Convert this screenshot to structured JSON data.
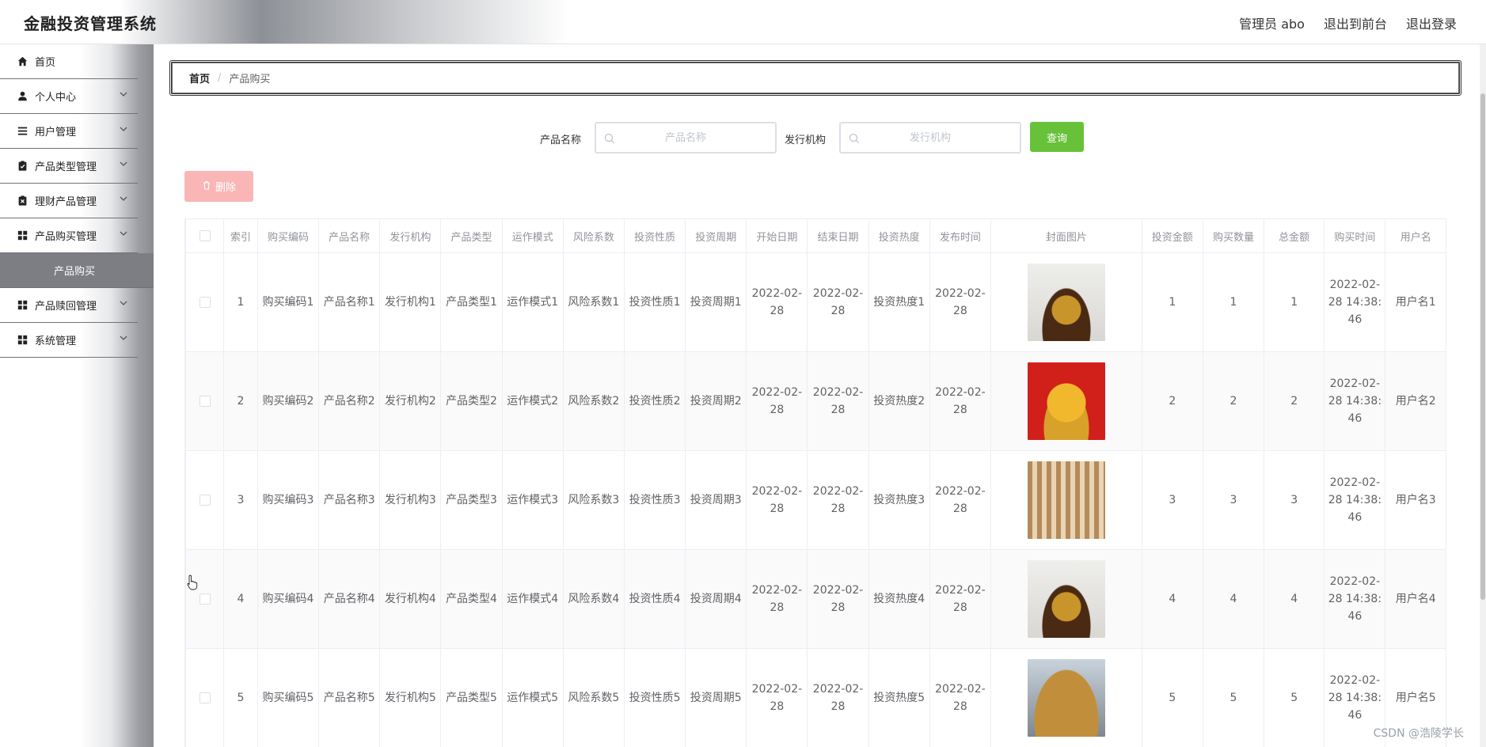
{
  "header": {
    "title": "金融投资管理系统",
    "user": "管理员 abo",
    "to_front": "退出到前台",
    "logout": "退出登录"
  },
  "sidebar": {
    "items": [
      {
        "label": "首页",
        "icon": "home-icon",
        "has_children": false
      },
      {
        "label": "个人中心",
        "icon": "user-icon",
        "has_children": true
      },
      {
        "label": "用户管理",
        "icon": "list-icon",
        "has_children": true
      },
      {
        "label": "产品类型管理",
        "icon": "clipboard-check-icon",
        "has_children": true
      },
      {
        "label": "理财产品管理",
        "icon": "clipboard-x-icon",
        "has_children": true
      },
      {
        "label": "产品购买管理",
        "icon": "grid-icon",
        "has_children": true
      },
      {
        "label": "产品购买",
        "is_sub": true,
        "active": true
      },
      {
        "label": "产品赎回管理",
        "icon": "grid-icon",
        "has_children": true
      },
      {
        "label": "系统管理",
        "icon": "grid-icon",
        "has_children": true
      }
    ]
  },
  "breadcrumb": {
    "home": "首页",
    "separator": "/",
    "current": "产品购买"
  },
  "search": {
    "name_label": "产品名称",
    "name_placeholder": "产品名称",
    "org_label": "发行机构",
    "org_placeholder": "发行机构",
    "query_button": "查询"
  },
  "actions": {
    "delete_button": "删除"
  },
  "table": {
    "headers": [
      "索引",
      "购买编码",
      "产品名称",
      "发行机构",
      "产品类型",
      "运作模式",
      "风险系数",
      "投资性质",
      "投资周期",
      "开始日期",
      "结束日期",
      "投资热度",
      "发布时间",
      "封面图片",
      "投资金额",
      "购买数量",
      "总金额",
      "购买时间",
      "用户名"
    ],
    "rows": [
      {
        "index": "1",
        "code": "购买编码1",
        "name": "产品名称1",
        "org": "发行机构1",
        "type": "产品类型1",
        "mode": "运作模式1",
        "risk": "风险系数1",
        "nature": "投资性质1",
        "period": "投资周期1",
        "start": "2022-02-28",
        "end": "2022-02-28",
        "heat": "投资热度1",
        "publish": "2022-02-28",
        "cover": "gold-coins-bowl",
        "amount": "1",
        "qty": "1",
        "total": "1",
        "buy_time": "2022-02-28 14:38:46",
        "user": "用户名1"
      },
      {
        "index": "2",
        "code": "购买编码2",
        "name": "产品名称2",
        "org": "发行机构2",
        "type": "产品类型2",
        "mode": "运作模式2",
        "risk": "风险系数2",
        "nature": "投资性质2",
        "period": "投资周期2",
        "start": "2022-02-28",
        "end": "2022-02-28",
        "heat": "投资热度2",
        "publish": "2022-02-28",
        "cover": "money-bag-red",
        "amount": "2",
        "qty": "2",
        "total": "2",
        "buy_time": "2022-02-28 14:38:46",
        "user": "用户名2"
      },
      {
        "index": "3",
        "code": "购买编码3",
        "name": "产品名称3",
        "org": "发行机构3",
        "type": "产品类型3",
        "mode": "运作模式3",
        "risk": "风险系数3",
        "nature": "投资性质3",
        "period": "投资周期3",
        "start": "2022-02-28",
        "end": "2022-02-28",
        "heat": "投资热度3",
        "publish": "2022-02-28",
        "cover": "abacus",
        "amount": "3",
        "qty": "3",
        "total": "3",
        "buy_time": "2022-02-28 14:38:46",
        "user": "用户名3"
      },
      {
        "index": "4",
        "code": "购买编码4",
        "name": "产品名称4",
        "org": "发行机构4",
        "type": "产品类型4",
        "mode": "运作模式4",
        "risk": "风险系数4",
        "nature": "投资性质4",
        "period": "投资周期4",
        "start": "2022-02-28",
        "end": "2022-02-28",
        "heat": "投资热度4",
        "publish": "2022-02-28",
        "cover": "gold-coins-bowl",
        "amount": "4",
        "qty": "4",
        "total": "4",
        "buy_time": "2022-02-28 14:38:46",
        "user": "用户名4"
      },
      {
        "index": "5",
        "code": "购买编码5",
        "name": "产品名称5",
        "org": "发行机构5",
        "type": "产品类型5",
        "mode": "运作模式5",
        "risk": "风险系数5",
        "nature": "投资性质5",
        "period": "投资周期5",
        "start": "2022-02-28",
        "end": "2022-02-28",
        "heat": "投资热度5",
        "publish": "2022-02-28",
        "cover": "coin-stacks-businessman",
        "amount": "5",
        "qty": "5",
        "total": "5",
        "buy_time": "2022-02-28 14:38:46",
        "user": "用户名5"
      }
    ]
  },
  "watermark": "CSDN @浩陵学长"
}
